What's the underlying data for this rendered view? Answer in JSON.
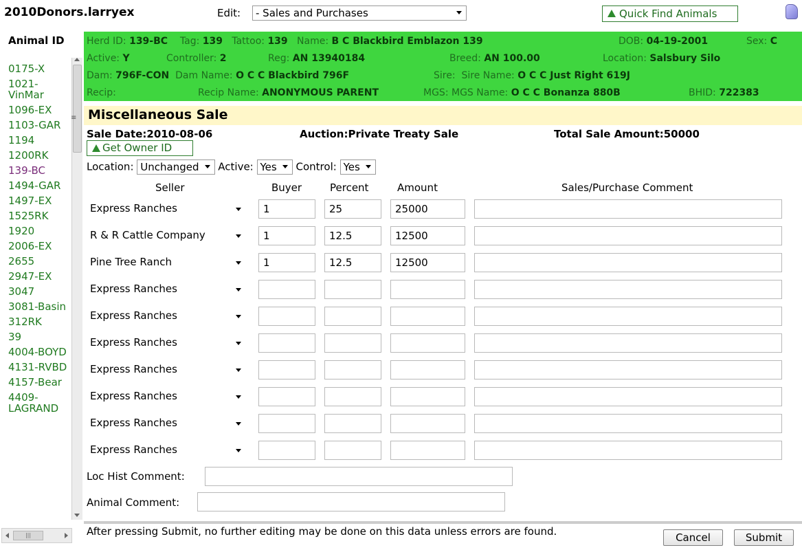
{
  "app": {
    "title": "2010Donors.larryex",
    "edit_label": "Edit:",
    "edit_value": "- Sales and Purchases",
    "quick_find_label": "Quick Find Animals"
  },
  "sidebar": {
    "heading": "Animal ID",
    "items": [
      {
        "label": "0175-X"
      },
      {
        "label": "1021-VinMar"
      },
      {
        "label": "1096-EX"
      },
      {
        "label": "1103-GAR"
      },
      {
        "label": "1194"
      },
      {
        "label": "1200RK"
      },
      {
        "label": "139-BC"
      },
      {
        "label": "1494-GAR"
      },
      {
        "label": "1497-EX"
      },
      {
        "label": "1525RK"
      },
      {
        "label": "1920"
      },
      {
        "label": "2006-EX"
      },
      {
        "label": "2655"
      },
      {
        "label": "2947-EX"
      },
      {
        "label": "3047"
      },
      {
        "label": "3081-Basin"
      },
      {
        "label": "312RK"
      },
      {
        "label": "39"
      },
      {
        "label": "4004-BOYD"
      },
      {
        "label": "4131-RVBD"
      },
      {
        "label": "4157-Bear"
      },
      {
        "label": "4409-LAGRAND"
      }
    ],
    "selected": "139-BC"
  },
  "info": {
    "herd_label": "Herd ID:",
    "herd_value": "139-BC",
    "tag_label": "Tag:",
    "tag_value": "139",
    "tattoo_label": "Tattoo:",
    "tattoo_value": "139",
    "name_label": "Name:",
    "name_value": "B C Blackbird Emblazon 139",
    "dob_label": "DOB:",
    "dob_value": "04-19-2001",
    "sex_label": "Sex:",
    "sex_value": "C",
    "active_label": "Active:",
    "active_value": "Y",
    "controller_label": "Controller:",
    "controller_value": "2",
    "reg_label": "Reg:",
    "reg_value": "AN 13940184",
    "breed_label": "Breed:",
    "breed_value": "AN 100.00",
    "location_label": "Location:",
    "location_value": "Salsbury Silo",
    "dam_label": "Dam:",
    "dam_value": "796F-CON",
    "dam_name_label": "Dam Name:",
    "dam_name_value": "O C C Blackbird 796F",
    "sire_label": "Sire:",
    "sire_name_label": "Sire Name:",
    "sire_name_value": "O C C Just Right 619J",
    "recip_label": "Recip:",
    "recip_name_label": "Recip Name:",
    "recip_name_value": "ANONYMOUS PARENT",
    "mgs_label": "MGS:",
    "mgs_name_label": "MGS Name:",
    "mgs_name_value": "O C C Bonanza 880B",
    "bhid_label": "BHID:",
    "bhid_value": "722383"
  },
  "section": {
    "title": "Miscellaneous Sale",
    "sale_date": "Sale Date:2010-08-06",
    "auction": "Auction:Private Treaty Sale",
    "total": "Total Sale Amount:50000",
    "get_owner_label": "Get Owner ID"
  },
  "controls": {
    "location_label": "Location:",
    "location_value": "Unchanged",
    "active_label": "Active:",
    "active_value": "Yes",
    "control_label": "Control:",
    "control_value": "Yes"
  },
  "table": {
    "headers": {
      "seller": "Seller",
      "buyer": "Buyer",
      "percent": "Percent",
      "amount": "Amount",
      "comment": "Sales/Purchase Comment"
    },
    "rows": [
      {
        "seller": "Express Ranches",
        "buyer": "1",
        "percent": "25",
        "amount": "25000",
        "comment": ""
      },
      {
        "seller": "R & R Cattle Company",
        "buyer": "1",
        "percent": "12.5",
        "amount": "12500",
        "comment": ""
      },
      {
        "seller": "Pine Tree Ranch",
        "buyer": "1",
        "percent": "12.5",
        "amount": "12500",
        "comment": ""
      },
      {
        "seller": "Express Ranches",
        "buyer": "",
        "percent": "",
        "amount": "",
        "comment": ""
      },
      {
        "seller": "Express Ranches",
        "buyer": "",
        "percent": "",
        "amount": "",
        "comment": ""
      },
      {
        "seller": "Express Ranches",
        "buyer": "",
        "percent": "",
        "amount": "",
        "comment": ""
      },
      {
        "seller": "Express Ranches",
        "buyer": "",
        "percent": "",
        "amount": "",
        "comment": ""
      },
      {
        "seller": "Express Ranches",
        "buyer": "",
        "percent": "",
        "amount": "",
        "comment": ""
      },
      {
        "seller": "Express Ranches",
        "buyer": "",
        "percent": "",
        "amount": "",
        "comment": ""
      },
      {
        "seller": "Express Ranches",
        "buyer": "",
        "percent": "",
        "amount": "",
        "comment": ""
      }
    ]
  },
  "comments": {
    "loc_hist_label": "Loc Hist Comment:",
    "animal_label": "Animal Comment:"
  },
  "footer": {
    "note": "After pressing Submit, no further editing may be done on this data unless errors are found.",
    "cancel_label": "Cancel",
    "submit_label": "Submit"
  },
  "colors": {
    "info_bg": "#3fd63f",
    "section_bg": "#fff7c9",
    "link_green": "#1f7a1f",
    "selected_purple": "#7a2d7a"
  }
}
